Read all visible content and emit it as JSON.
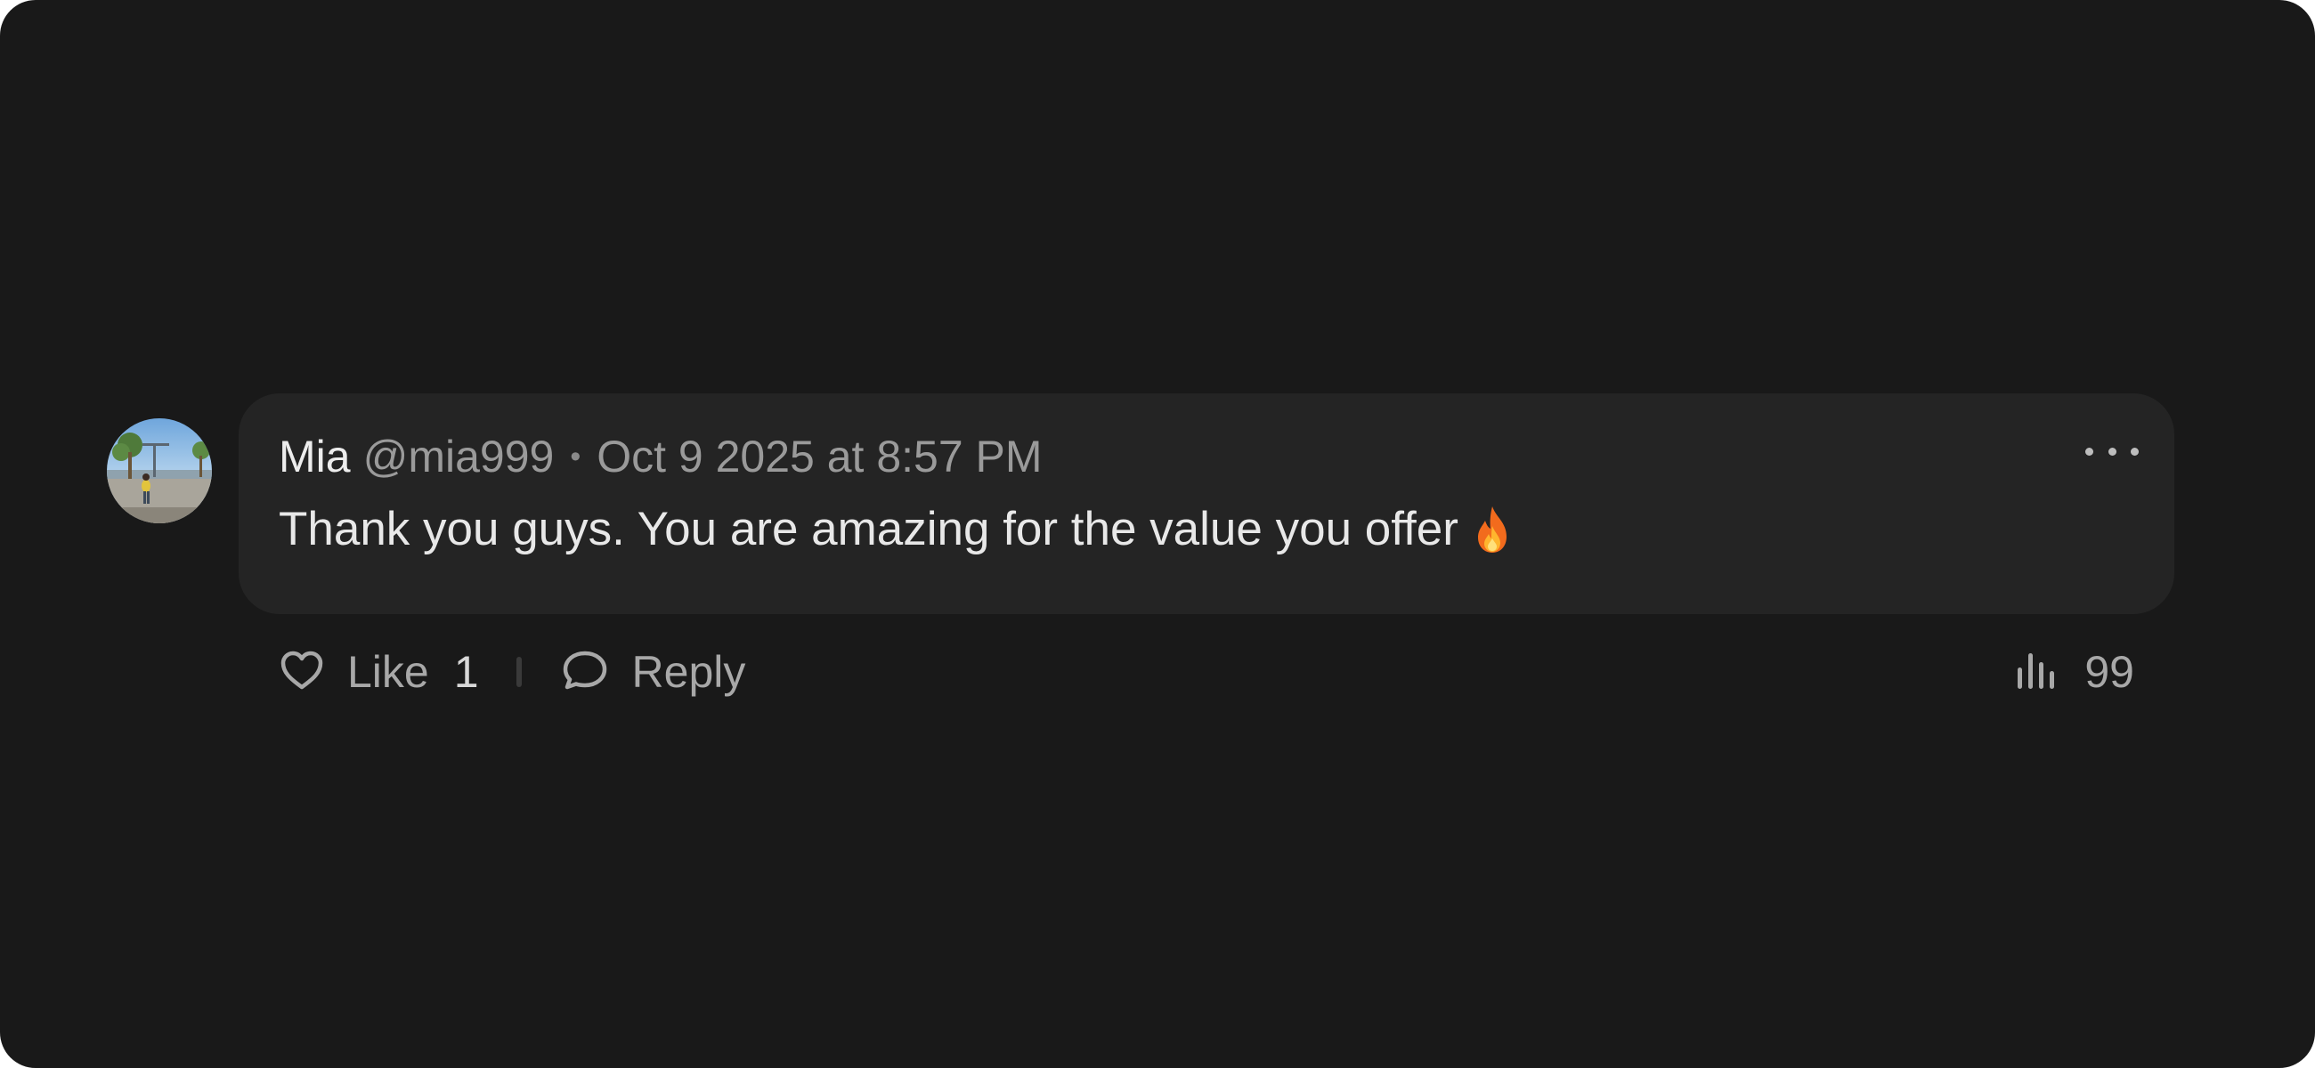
{
  "comment": {
    "author_name": "Mia",
    "author_handle": "@mia999",
    "separator": "•",
    "timestamp": "Oct 9 2025 at 8:57 PM",
    "message": "Thank you guys. You are amazing for the value you offer",
    "message_emoji": "fire-icon",
    "more_icon": "more-horizontal-icon"
  },
  "actions": {
    "like_label": "Like",
    "like_count": "1",
    "reply_label": "Reply",
    "views_count": "99"
  },
  "colors": {
    "background": "#191919",
    "bubble": "#242424",
    "primary_text": "#ededed",
    "secondary_text": "#9a9a9a"
  }
}
